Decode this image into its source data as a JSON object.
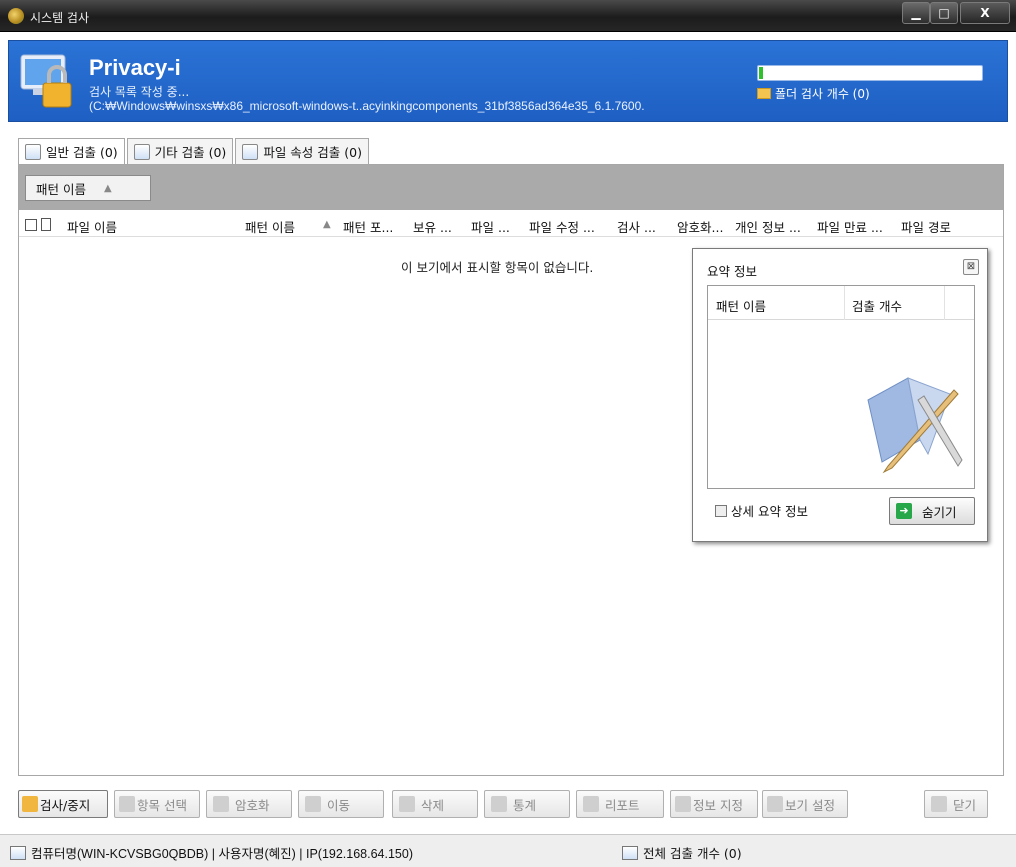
{
  "window": {
    "title": "시스템 검사"
  },
  "header": {
    "app_name": "Privacy-i",
    "status": "검사 목록 작성 중...",
    "current_path": "(C:₩Windows₩winsxs₩x86_microsoft-windows-t..acyinkingcomponents_31bf3856ad364e35_6.1.7600.",
    "progress": 0.02,
    "folder_count_label": "폴더 검사 개수 (0)"
  },
  "tabs": [
    {
      "label": "일반 검출 (0)",
      "icon": "checklist-icon",
      "active": true
    },
    {
      "label": "기타 검출 (0)",
      "icon": "folder-hand-icon",
      "active": false
    },
    {
      "label": "파일 속성 검출 (0)",
      "icon": "file-properties-icon",
      "active": false
    }
  ],
  "grouping": {
    "label": "패턴 이름"
  },
  "columns": [
    "파일 이름",
    "패턴 이름",
    "패턴 포...",
    "보유 ...",
    "파일 ...",
    "파일 수정 ...",
    "검사 ...",
    "암호화...",
    "개인 정보 ...",
    "파일 만료 ...",
    "파일 경로"
  ],
  "empty_message": "이 보기에서 표시할 항목이 없습니다.",
  "summary": {
    "title": "요약 정보",
    "columns": [
      "패턴 이름",
      "검출 개수"
    ],
    "detail_label": "상세 요약 정보",
    "hide_label": "숨기기"
  },
  "toolbar": {
    "scan_stop": "검사/중지",
    "select_items": "항목 선택",
    "encrypt": "암호화",
    "move": "이동",
    "delete": "삭제",
    "stats": "통계",
    "report": "리포트",
    "info_set": "정보 지정",
    "view_settings": "보기 설정",
    "close": "닫기"
  },
  "statusbar": {
    "machine_info": "컴퓨터명(WIN-KCVSBG0QBDB) | 사용자명(혜진) | IP(192.168.64.150)",
    "total_count": "전체 검출 개수 (0)"
  }
}
